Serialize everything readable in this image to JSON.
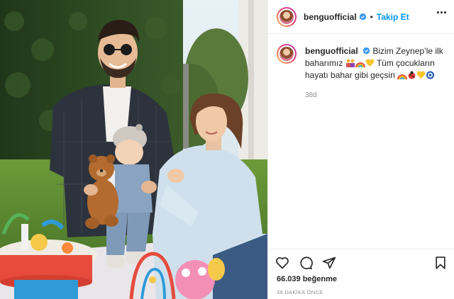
{
  "header": {
    "username": "benguofficial",
    "verified_icon": "verified-badge-icon",
    "separator": "•",
    "follow_label": "Takip Et",
    "more_icon": "more-options-icon"
  },
  "caption": {
    "username": "benguofficial",
    "text_part1": "Bizim Zeynep’le ilk baharımız",
    "text_part2": " Tüm çocukların hayatı bahar gibi geçsin",
    "time_ago": "38d"
  },
  "actions": {
    "like_icon": "heart-icon",
    "comment_icon": "comment-icon",
    "share_icon": "share-icon",
    "save_icon": "bookmark-icon",
    "likes_text": "66.039 beğenme",
    "posted_time": "38 DAKİKA ÖNCE"
  },
  "photo": {
    "description_icon": "post-photo"
  },
  "colors": {
    "accent": "#0095f6",
    "verified": "#3897f0",
    "text": "#262626",
    "muted": "#8e8e8e",
    "border": "#efefef"
  }
}
